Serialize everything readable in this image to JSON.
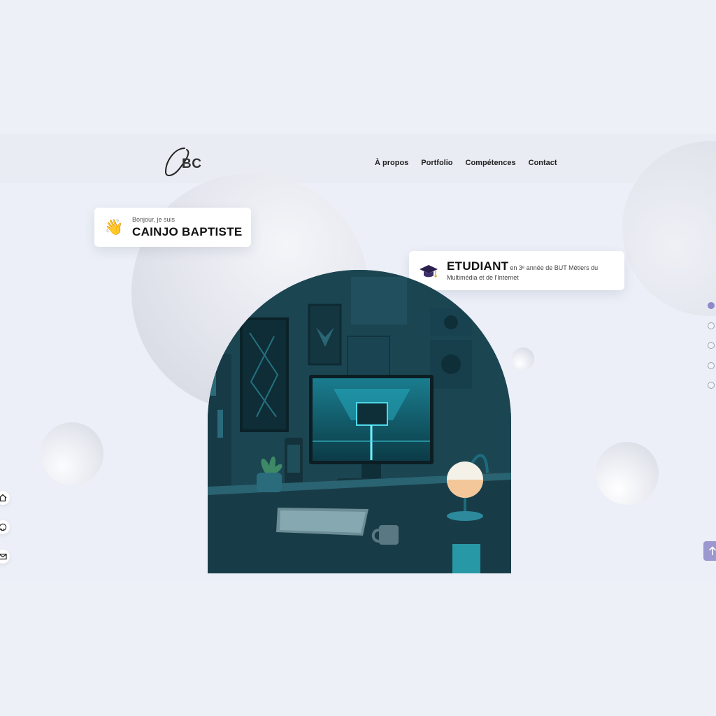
{
  "logo": {
    "text": "BC"
  },
  "nav": {
    "items": [
      "À propos",
      "Portfolio",
      "Compétences",
      "Contact"
    ]
  },
  "intro": {
    "greeting": "Bonjour, je suis",
    "name": "CAINJO BAPTISTE",
    "emoji": "👋"
  },
  "status": {
    "title": "ETUDIANT",
    "detail_line1": "en 3ᵉ année de BUT Métiers du",
    "detail_line2": "Multimédia et de l'Internet",
    "icon": "graduation-cap-icon"
  },
  "hero_image": {
    "subject": "desk-setup-illustration"
  },
  "section_dots": {
    "count": 5,
    "active_index": 0
  },
  "social": {
    "icons": [
      "house-icon",
      "github-icon",
      "mail-icon"
    ]
  },
  "colors": {
    "accent": "#8e89c8",
    "background": "#eef0f7",
    "hero_teal": "#1e4a57",
    "lamp_glow": "#d9573a"
  },
  "icons": {
    "scroll_top": "arrow-up-icon"
  }
}
